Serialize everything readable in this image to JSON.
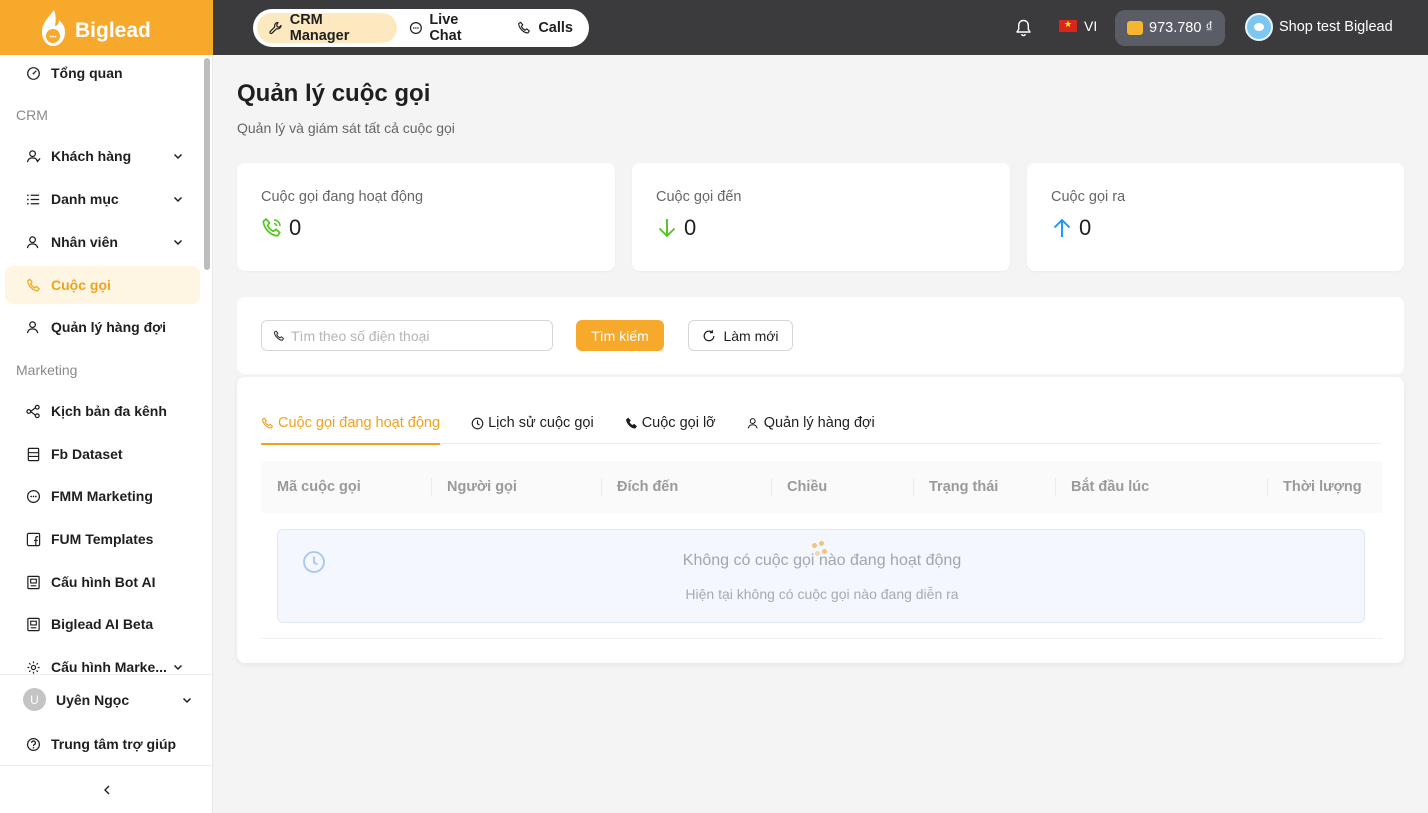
{
  "brand": {
    "name": "Biglead",
    "color": "#f6a92b"
  },
  "top_nav": {
    "items": [
      {
        "label": "CRM Manager",
        "icon": "wrench-icon",
        "active": true
      },
      {
        "label": "Live Chat",
        "icon": "chat-bubble-icon",
        "active": false
      },
      {
        "label": "Calls",
        "icon": "phone-icon",
        "active": false
      }
    ],
    "language": "VI",
    "balance": "973.780 ₫",
    "shop_name": "Shop test Biglead"
  },
  "sidebar": {
    "items": [
      {
        "label": "Tổng quan",
        "icon": "dashboard-icon"
      },
      {
        "label": "Khách hàng",
        "icon": "users-icon",
        "expandable": true
      },
      {
        "label": "Danh mục",
        "icon": "list-icon",
        "expandable": true
      },
      {
        "label": "Nhân viên",
        "icon": "staff-icon",
        "expandable": true
      },
      {
        "label": "Cuộc gọi",
        "icon": "phone-icon",
        "active": true
      },
      {
        "label": "Quản lý hàng đợi",
        "icon": "queue-icon"
      },
      {
        "label": "Kịch bản đa kênh",
        "icon": "flow-icon"
      },
      {
        "label": "Fb Dataset",
        "icon": "dataset-icon"
      },
      {
        "label": "FMM Marketing",
        "icon": "message-icon"
      },
      {
        "label": "FUM Templates",
        "icon": "facebook-icon"
      },
      {
        "label": "Cấu hình Bot AI",
        "icon": "bot-icon"
      },
      {
        "label": "Biglead AI Beta",
        "icon": "ai-icon"
      },
      {
        "label": "Cấu hình Marke...",
        "icon": "settings-icon",
        "expandable": true
      }
    ],
    "sections": {
      "crm": "CRM",
      "marketing": "Marketing"
    },
    "user": {
      "initial": "U",
      "name": "Uyên Ngọc"
    },
    "help": "Trung tâm trợ giúp"
  },
  "page": {
    "title": "Quản lý cuộc gọi",
    "subtitle": "Quản lý và giám sát tất cả cuộc gọi"
  },
  "stats": [
    {
      "label": "Cuộc gọi đang hoạt động",
      "value": "0",
      "icon": "phone-active-icon",
      "color": "#52c41a"
    },
    {
      "label": "Cuộc gọi đến",
      "value": "0",
      "icon": "arrow-down-icon",
      "color": "#52c41a"
    },
    {
      "label": "Cuộc gọi ra",
      "value": "0",
      "icon": "arrow-up-icon",
      "color": "#1890ff"
    }
  ],
  "search": {
    "placeholder": "Tìm theo số điện thoại",
    "value": "",
    "search_label": "Tìm kiếm",
    "refresh_label": "Làm mới"
  },
  "tabs": [
    {
      "label": "Cuộc gọi đang hoạt động",
      "icon": "phone-icon",
      "active": true
    },
    {
      "label": "Lịch sử cuộc gọi",
      "icon": "clock-icon",
      "active": false
    },
    {
      "label": "Cuộc gọi lỡ",
      "icon": "phone-missed-icon",
      "active": false
    },
    {
      "label": "Quản lý hàng đợi",
      "icon": "queue-icon",
      "active": false
    }
  ],
  "table": {
    "columns": [
      "Mã cuộc gọi",
      "Người gọi",
      "Đích đến",
      "Chiều",
      "Trạng thái",
      "Bắt đầu lúc",
      "Thời lượng"
    ],
    "rows": []
  },
  "empty": {
    "title": "Không có cuộc gọi nào đang hoạt động",
    "description": "Hiện tại không có cuộc gọi nào đang diễn ra"
  }
}
